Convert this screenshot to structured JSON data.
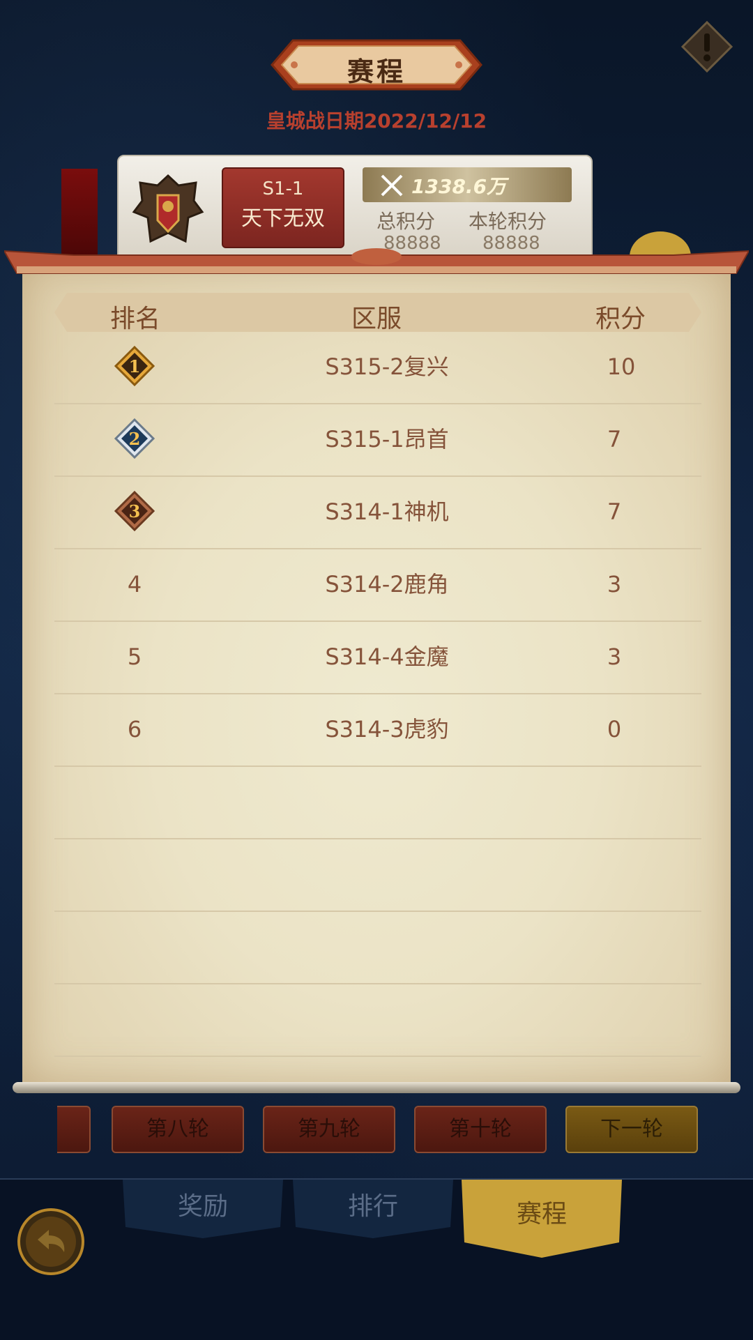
{
  "header": {
    "title": "赛程",
    "date_line": "皇城战日期2022/12/12"
  },
  "guild": {
    "server_id": "S1-1",
    "name": "天下无双",
    "power": "1338.6万",
    "total_points_label": "总积分",
    "total_points_value": "88888",
    "round_points_label": "本轮积分",
    "round_points_value": "88888"
  },
  "table": {
    "headers": {
      "rank": "排名",
      "server": "区服",
      "points": "积分"
    },
    "rows": [
      {
        "rank": "1",
        "server": "S315-2复兴",
        "points": "10",
        "medal": "gold-medal-icon"
      },
      {
        "rank": "2",
        "server": "S315-1昂首",
        "points": "7",
        "medal": "silver-medal-icon"
      },
      {
        "rank": "3",
        "server": "S314-1神机",
        "points": "7",
        "medal": "bronze-medal-icon"
      },
      {
        "rank": "4",
        "server": "S314-2鹿角",
        "points": "3"
      },
      {
        "rank": "5",
        "server": "S314-4金魔",
        "points": "3"
      },
      {
        "rank": "6",
        "server": "S314-3虎豹",
        "points": "0"
      }
    ]
  },
  "rounds": {
    "items": [
      "第八轮",
      "第九轮",
      "第十轮"
    ],
    "next": "下一轮"
  },
  "tabs": {
    "rewards": "奖励",
    "ranking": "排行",
    "schedule": "赛程"
  },
  "colors": {
    "accent_gold": "#c9a23a",
    "text_brown": "#85533a",
    "date_red": "#b8402e"
  }
}
